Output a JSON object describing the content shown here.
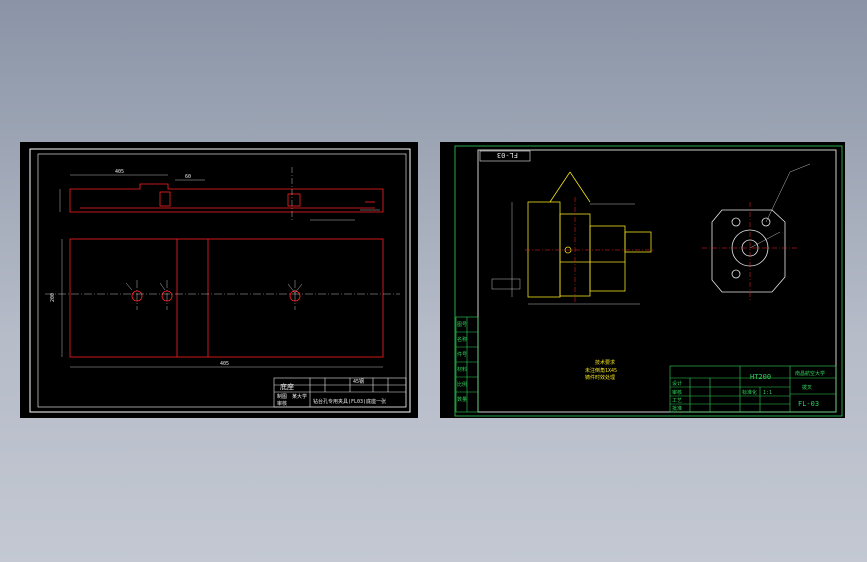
{
  "colors": {
    "background_top": "#8a94a6",
    "background_bottom": "#c3c8d2",
    "sheet": "#000000",
    "frame_white": "#ffffff",
    "frame_green": "#2fd35a",
    "part_red": "#ff2020",
    "part_yellow": "#f0e020",
    "dim_cyan": "#4ad0d8",
    "text_white": "#e8e8e8"
  },
  "left_drawing": {
    "title_block": {
      "cell_name": "底座",
      "cell_material": "45钢",
      "cell_drawn": "制图",
      "cell_check": "审核",
      "cell_school": "某大学",
      "caption": "钻台孔专用夹具(FL03)底座一张"
    },
    "dims": {
      "top_length": "405",
      "top_step": "60",
      "width_label": "200",
      "bottom_length": "405"
    }
  },
  "right_drawing": {
    "drawing_code_box": "FL-03",
    "tech_notes": {
      "heading": "技术要求",
      "line1": "未注倒角1X45",
      "line2": "铸件时效处理"
    },
    "material": "HT200",
    "title_block": {
      "school": "南昌航空大学",
      "code": "FL-03",
      "labels": [
        "设计",
        "审核",
        "工艺",
        "批准",
        "标准化"
      ],
      "part_name": "拨叉",
      "scale": "1:1"
    },
    "left_column_labels": [
      "图号",
      "名称",
      "件号",
      "材料",
      "比例",
      "数量"
    ]
  }
}
